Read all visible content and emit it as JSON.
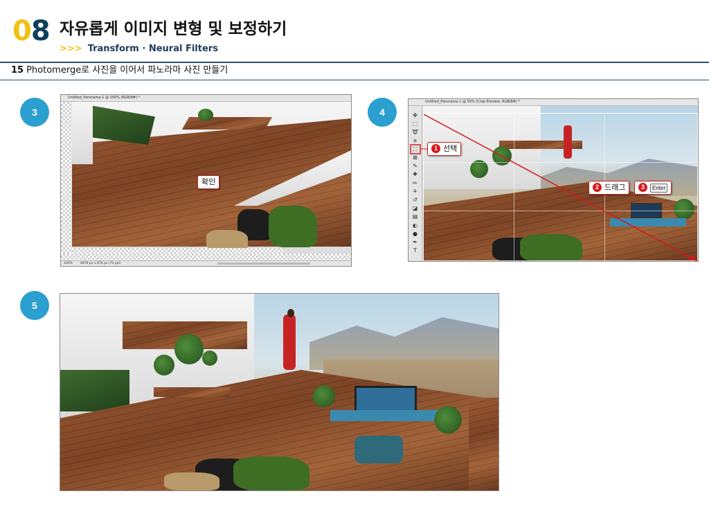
{
  "header": {
    "chapter_digit_0": "0",
    "chapter_digit_1": "8",
    "title": "자유롭게 이미지 변형 및 보정하기",
    "sub_arrows": ">>>",
    "subtitle": "Transform · Neural Filters",
    "section_number": "15",
    "section_title": "Photomerge로 사진을 이어서 파노라마 사진 만들기"
  },
  "colors": {
    "accent_yellow": "#f2c012",
    "navy": "#0f3e5c",
    "badge_blue": "#2b9fd0",
    "callout_red": "#d7191c"
  },
  "steps": [
    {
      "number": "3"
    },
    {
      "number": "4"
    },
    {
      "number": "5"
    }
  ],
  "shot3": {
    "tab_title": "Untitled_Panorama-1 @ 100% (RGB/8#) *",
    "status_zoom": "100%",
    "status_info": "6876 px x 876 px (72 ppi)",
    "callout": "확인"
  },
  "shot4": {
    "tab_title": "Untitled_Panorama-1 @ 50% (Crop Preview, RGB/8#) *",
    "callout_1_num": "1",
    "callout_1": "선택",
    "callout_2_num": "2",
    "callout_2": "드래그",
    "callout_3_num": "3",
    "callout_3_key": "Enter",
    "tool_icons": [
      "move-tool-icon",
      "marquee-tool-icon",
      "lasso-tool-icon",
      "magic-wand-tool-icon",
      "crop-tool-icon",
      "frame-tool-icon",
      "eyedropper-tool-icon",
      "healing-brush-tool-icon",
      "brush-tool-icon",
      "clone-stamp-tool-icon",
      "history-brush-tool-icon",
      "eraser-tool-icon",
      "gradient-tool-icon",
      "blur-tool-icon",
      "dodge-tool-icon",
      "pen-tool-icon",
      "type-tool-icon"
    ]
  }
}
